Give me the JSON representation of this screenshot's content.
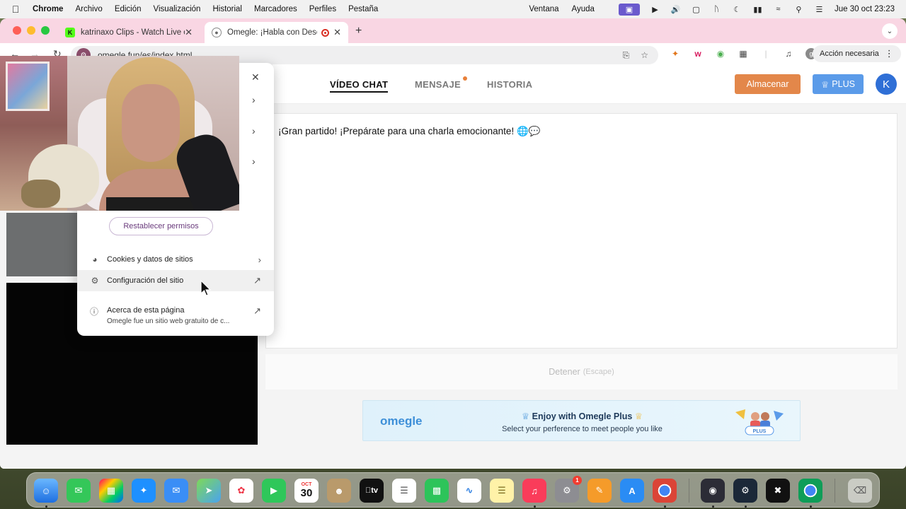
{
  "menubar": {
    "apple_icon": "apple-icon",
    "app_name": "Chrome",
    "items": [
      "Archivo",
      "Edición",
      "Visualización",
      "Historial",
      "Marcadores",
      "Perfiles",
      "Pestaña",
      "Ventana",
      "Ayuda"
    ],
    "clock": "Jue 30 oct  23:23"
  },
  "tabs": [
    {
      "title": "katrinaxo Clips - Watch Live on",
      "favicon": "kick-icon",
      "active": false
    },
    {
      "title": "Omegle: ¡Habla con Desconocidos!",
      "favicon": "globe-icon",
      "active": true
    }
  ],
  "toolbar": {
    "url": "omegle.fun/es/index.html",
    "action_button": "Acción necesaria",
    "profile_initial": "g"
  },
  "site": {
    "nav": [
      {
        "label": "VÍDEO CHAT",
        "active": true
      },
      {
        "label": "MENSAJE",
        "active": false,
        "dot": true
      },
      {
        "label": "HISTORIA",
        "active": false
      }
    ],
    "store_button": "Almacenar",
    "plus_button": "PLUS",
    "avatar_initial": "K",
    "chat_message": "¡Gran partido! ¡Prepárate para una charla emocionante! 🌐💬",
    "stop_label": "Detener",
    "stop_key": "(Escape)",
    "promo": {
      "logo": "omegle",
      "title": "Enjoy with Omegle Plus",
      "subtitle": "Select your perference to meet people you like",
      "art_badge": "PLUS"
    }
  },
  "popup": {
    "reset_button": "Restablecer permisos",
    "rows": [
      {
        "label": "Cookies y datos de sitios",
        "icon": "cookie-icon",
        "trailing": "chevron-right-icon"
      },
      {
        "label": "Configuración del sitio",
        "icon": "gear-icon",
        "trailing": "external-link-icon"
      }
    ],
    "about_title": "Acerca de esta página",
    "about_desc": "Omegle fue un sitio web gratuito de c..."
  },
  "dock": {
    "calendar_month": "OCT",
    "calendar_day": "30",
    "tv_label": "tv",
    "settings_badge": "1",
    "apps": [
      "finder-icon",
      "messages-icon",
      "launchpad-icon",
      "safari-icon",
      "mail-icon",
      "maps-icon",
      "photos-icon",
      "facetime-icon",
      "calendar-icon",
      "contacts-icon",
      "appletv-icon",
      "reminders-icon",
      "numbers-icon",
      "freeform-icon",
      "notes-icon",
      "music-icon",
      "settings-icon",
      "pages-icon",
      "appstore-icon",
      "chrome-icon",
      "obs-icon",
      "steam-icon",
      "capcut-icon",
      "chrome-alt-icon",
      "trash-icon"
    ]
  },
  "colors": {
    "tabstrip": "#f9d6e3",
    "store_button": "#e3874a",
    "plus_button": "#5b9be9",
    "avatar": "#2f6fd6",
    "reset_button_text": "#6a3b7c"
  }
}
